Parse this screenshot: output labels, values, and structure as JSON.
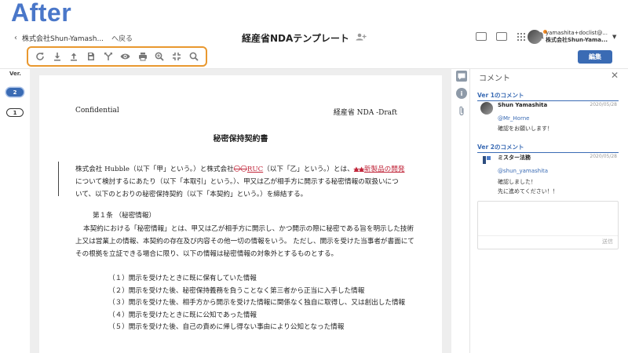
{
  "overlay": {
    "after_label": "After"
  },
  "header": {
    "back": {
      "chevron": "‹",
      "workspace": "株式会社Shun-Yamash...",
      "back_label": "へ戻る"
    },
    "title": "経産省NDAテンプレート",
    "user": {
      "email": "yamashita+doclist@...",
      "org": "株式会社Shun-Yama..."
    }
  },
  "toolbar": {
    "icons": [
      "refresh-icon",
      "download-icon",
      "upload-icon",
      "save-file-icon",
      "merge-icon",
      "eye-icon",
      "print-icon",
      "zoom-in-icon",
      "collapse-icon",
      "search-icon"
    ],
    "edit_label": "編集"
  },
  "versions": {
    "label": "Ver.",
    "items": [
      "2",
      "1"
    ],
    "active": "2"
  },
  "document": {
    "confidential": "Confidential",
    "draft": "経産省 NDA -Draft",
    "heading": "秘密保持契約書",
    "intro": {
      "p1": "株式会社 Hubble（以下「甲」という。）と株式会社",
      "deleted": "〇〇",
      "inserted1": "RUC",
      "p2": "（以下「乙」という。）とは、",
      "deleted2": "▲▲",
      "inserted2": "新製品の開発",
      "p3": "について検討するにあたり（以下「本取引」という。）、甲又は乙が相手方に開示する秘密情報の取扱いについて、以下のとおりの秘密保持契約（以下「本契約」という。）を締結する。"
    },
    "article_title": "第１条 （秘密情報）",
    "article_body": "本契約における「秘密情報」とは、甲又は乙が相手方に開示し、かつ開示の際に秘密である旨を明示した技術上又は営業上の情報、本契約の存在及び内容その他一切の情報をいう。 ただし、開示を受けた当事者が書面にてその根拠を立証できる場合に限り、以下の情報は秘密情報の対象外とするものとする。",
    "items": [
      "（１）開示を受けたときに既に保有していた情報",
      "（２）開示を受けた後、秘密保持義務を負うことなく第三者から正当に入手した情報",
      "（３）開示を受けた後、相手方から開示を受けた情報に関係なく独自に取得し、又は創出した情報",
      "（４）開示を受けたときに既に公知であった情報",
      "（５）開示を受けた後、自己の責めに帰し得ない事由により公知となった情報"
    ]
  },
  "comments": {
    "title": "コメント",
    "sections": [
      {
        "label": "Ver 1のコメント",
        "author": "Shun Yamashita",
        "date": "2020/05/28",
        "mention": "@Mr_Horne",
        "text": "確認をお願いします！"
      },
      {
        "label": "Ver 2のコメント",
        "author": "ミスター法務",
        "date": "2020/05/28",
        "mention": "@shun_yamashita",
        "text_line1": "確認しました！",
        "text_line2": "先に進めてください！！"
      }
    ],
    "send_label": "送信"
  }
}
